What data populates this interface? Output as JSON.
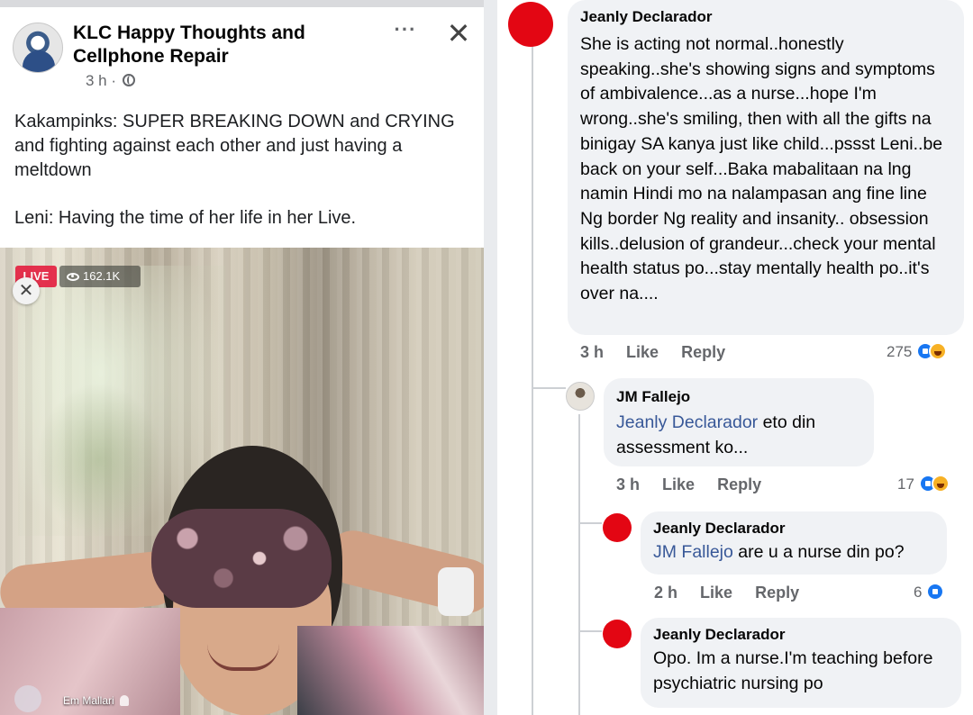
{
  "post": {
    "page_name": "KLC Happy Thoughts and Cellphone Repair",
    "time": "3 h",
    "dot": "·",
    "more_label": "···",
    "close_label": "✕",
    "text_line1": "Kakampinks: SUPER BREAKING DOWN and CRYING and fighting against each other and just having a meltdown",
    "text_line2": "Leni: Having the time of her life in her Live.",
    "video": {
      "live_label": "LIVE",
      "viewers": "162.1K",
      "close_label": "✕",
      "broadcaster": "Em Mallari"
    }
  },
  "comments": [
    {
      "author": "Jeanly Declarador",
      "text": "She is acting not normal..honestly speaking..she's showing signs and symptoms of ambivalence...as a nurse...hope I'm wrong..she's smiling, then with all the gifts na binigay SA kanya just like child...pssst Leni..be back on your self...Baka mabalitaan na lng namin Hindi mo na nalampasan ang fine line Ng border Ng reality and insanity.. obsession kills..delusion of grandeur...check your mental health status po...stay mentally health po..it's over na....",
      "time": "3 h",
      "like": "Like",
      "reply": "Reply",
      "reaction_count": "275",
      "avatar_color": "#e30613"
    },
    {
      "author": "JM Fallejo",
      "mention": "Jeanly Declarador",
      "text": " eto din assessment ko...",
      "time": "3 h",
      "like": "Like",
      "reply": "Reply",
      "reaction_count": "17"
    },
    {
      "author": "Jeanly Declarador",
      "mention": "JM Fallejo",
      "text": " are u a nurse din po?",
      "time": "2 h",
      "like": "Like",
      "reply": "Reply",
      "reaction_count": "6"
    },
    {
      "author": "Jeanly Declarador",
      "text": "Opo. Im a nurse.I'm teaching before psychiatric nursing po"
    }
  ]
}
